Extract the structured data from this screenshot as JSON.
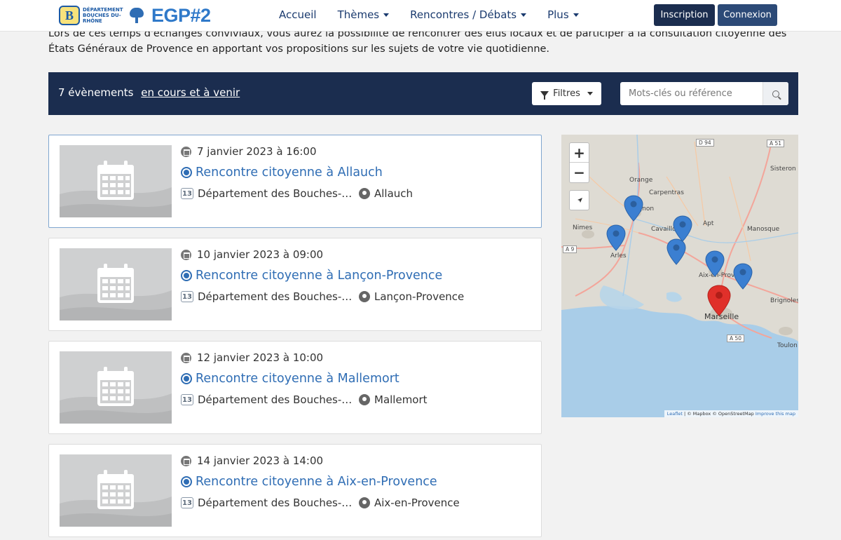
{
  "header": {
    "logo_dept_line1": "DÉPARTEMENT",
    "logo_dept_line2": "BOUCHES DU-RHÔNE",
    "logo_egp": "EGP#2",
    "nav": [
      {
        "label": "Accueil",
        "dropdown": false
      },
      {
        "label": "Thèmes",
        "dropdown": true
      },
      {
        "label": "Rencontres / Débats",
        "dropdown": true
      },
      {
        "label": "Plus",
        "dropdown": true
      }
    ],
    "signup_label": "Inscription",
    "login_label": "Connexion"
  },
  "intro": {
    "text": "Lors de ces temps d'échanges conviviaux, vous aurez la possibilité de rencontrer des élus locaux et de participer à la consultation citoyenne des États Généraux de Provence en apportant vos propositions sur les sujets de votre vie quotidienne."
  },
  "searchbar": {
    "count_label": "7 évènements",
    "period_link": "en cours et à venir",
    "filters_label": "Filtres",
    "keyword_placeholder": "Mots-clés ou référence"
  },
  "events": [
    {
      "date": "7 janvier 2023 à 16:00",
      "title": "Rencontre citoyenne à Allauch",
      "organizer": "Département des Bouches-du-Rhône",
      "location": "Allauch",
      "active": true
    },
    {
      "date": "10 janvier 2023 à 09:00",
      "title": "Rencontre citoyenne à Lançon-Provence",
      "organizer": "Département des Bouches-du-Rhône",
      "location": "Lançon-Provence",
      "active": false
    },
    {
      "date": "12 janvier 2023 à 10:00",
      "title": "Rencontre citoyenne à Mallemort",
      "organizer": "Département des Bouches-du-Rhône",
      "location": "Mallemort",
      "active": false
    },
    {
      "date": "14 janvier 2023 à 14:00",
      "title": "Rencontre citoyenne à Aix-en-Provence",
      "organizer": "Département des Bouches-du-Rhône",
      "location": "Aix-en-Provence",
      "active": false
    }
  ],
  "map": {
    "zoom_in": "+",
    "zoom_out": "−",
    "places": [
      "D 94",
      "A 51",
      "Sisteron",
      "Orange",
      "Carpentras",
      "Avignon",
      "Apt",
      "Manosque",
      "Nimes",
      "Cavaillon",
      "A 9",
      "Arles",
      "Aix-en-Provence",
      "Brignoles",
      "Marseille",
      "A 50",
      "Toulon"
    ],
    "attribution_leaflet": "Leaflet",
    "attribution_rest": "| © Mapbox © OpenStreetMap",
    "attribution_improve": "Improve this map",
    "marker_colors": {
      "default": "#3b7fd1",
      "active": "#e0302a"
    }
  }
}
